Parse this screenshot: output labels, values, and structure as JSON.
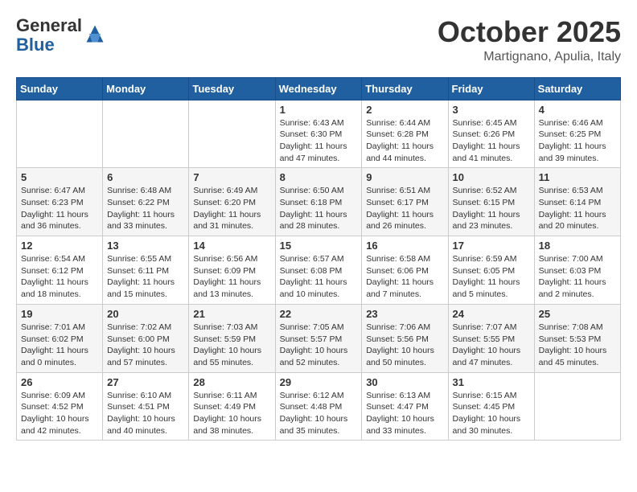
{
  "header": {
    "logo_general": "General",
    "logo_blue": "Blue",
    "month_title": "October 2025",
    "location": "Martignano, Apulia, Italy"
  },
  "weekdays": [
    "Sunday",
    "Monday",
    "Tuesday",
    "Wednesday",
    "Thursday",
    "Friday",
    "Saturday"
  ],
  "weeks": [
    [
      {
        "day": "",
        "info": ""
      },
      {
        "day": "",
        "info": ""
      },
      {
        "day": "",
        "info": ""
      },
      {
        "day": "1",
        "info": "Sunrise: 6:43 AM\nSunset: 6:30 PM\nDaylight: 11 hours\nand 47 minutes."
      },
      {
        "day": "2",
        "info": "Sunrise: 6:44 AM\nSunset: 6:28 PM\nDaylight: 11 hours\nand 44 minutes."
      },
      {
        "day": "3",
        "info": "Sunrise: 6:45 AM\nSunset: 6:26 PM\nDaylight: 11 hours\nand 41 minutes."
      },
      {
        "day": "4",
        "info": "Sunrise: 6:46 AM\nSunset: 6:25 PM\nDaylight: 11 hours\nand 39 minutes."
      }
    ],
    [
      {
        "day": "5",
        "info": "Sunrise: 6:47 AM\nSunset: 6:23 PM\nDaylight: 11 hours\nand 36 minutes."
      },
      {
        "day": "6",
        "info": "Sunrise: 6:48 AM\nSunset: 6:22 PM\nDaylight: 11 hours\nand 33 minutes."
      },
      {
        "day": "7",
        "info": "Sunrise: 6:49 AM\nSunset: 6:20 PM\nDaylight: 11 hours\nand 31 minutes."
      },
      {
        "day": "8",
        "info": "Sunrise: 6:50 AM\nSunset: 6:18 PM\nDaylight: 11 hours\nand 28 minutes."
      },
      {
        "day": "9",
        "info": "Sunrise: 6:51 AM\nSunset: 6:17 PM\nDaylight: 11 hours\nand 26 minutes."
      },
      {
        "day": "10",
        "info": "Sunrise: 6:52 AM\nSunset: 6:15 PM\nDaylight: 11 hours\nand 23 minutes."
      },
      {
        "day": "11",
        "info": "Sunrise: 6:53 AM\nSunset: 6:14 PM\nDaylight: 11 hours\nand 20 minutes."
      }
    ],
    [
      {
        "day": "12",
        "info": "Sunrise: 6:54 AM\nSunset: 6:12 PM\nDaylight: 11 hours\nand 18 minutes."
      },
      {
        "day": "13",
        "info": "Sunrise: 6:55 AM\nSunset: 6:11 PM\nDaylight: 11 hours\nand 15 minutes."
      },
      {
        "day": "14",
        "info": "Sunrise: 6:56 AM\nSunset: 6:09 PM\nDaylight: 11 hours\nand 13 minutes."
      },
      {
        "day": "15",
        "info": "Sunrise: 6:57 AM\nSunset: 6:08 PM\nDaylight: 11 hours\nand 10 minutes."
      },
      {
        "day": "16",
        "info": "Sunrise: 6:58 AM\nSunset: 6:06 PM\nDaylight: 11 hours\nand 7 minutes."
      },
      {
        "day": "17",
        "info": "Sunrise: 6:59 AM\nSunset: 6:05 PM\nDaylight: 11 hours\nand 5 minutes."
      },
      {
        "day": "18",
        "info": "Sunrise: 7:00 AM\nSunset: 6:03 PM\nDaylight: 11 hours\nand 2 minutes."
      }
    ],
    [
      {
        "day": "19",
        "info": "Sunrise: 7:01 AM\nSunset: 6:02 PM\nDaylight: 11 hours\nand 0 minutes."
      },
      {
        "day": "20",
        "info": "Sunrise: 7:02 AM\nSunset: 6:00 PM\nDaylight: 10 hours\nand 57 minutes."
      },
      {
        "day": "21",
        "info": "Sunrise: 7:03 AM\nSunset: 5:59 PM\nDaylight: 10 hours\nand 55 minutes."
      },
      {
        "day": "22",
        "info": "Sunrise: 7:05 AM\nSunset: 5:57 PM\nDaylight: 10 hours\nand 52 minutes."
      },
      {
        "day": "23",
        "info": "Sunrise: 7:06 AM\nSunset: 5:56 PM\nDaylight: 10 hours\nand 50 minutes."
      },
      {
        "day": "24",
        "info": "Sunrise: 7:07 AM\nSunset: 5:55 PM\nDaylight: 10 hours\nand 47 minutes."
      },
      {
        "day": "25",
        "info": "Sunrise: 7:08 AM\nSunset: 5:53 PM\nDaylight: 10 hours\nand 45 minutes."
      }
    ],
    [
      {
        "day": "26",
        "info": "Sunrise: 6:09 AM\nSunset: 4:52 PM\nDaylight: 10 hours\nand 42 minutes."
      },
      {
        "day": "27",
        "info": "Sunrise: 6:10 AM\nSunset: 4:51 PM\nDaylight: 10 hours\nand 40 minutes."
      },
      {
        "day": "28",
        "info": "Sunrise: 6:11 AM\nSunset: 4:49 PM\nDaylight: 10 hours\nand 38 minutes."
      },
      {
        "day": "29",
        "info": "Sunrise: 6:12 AM\nSunset: 4:48 PM\nDaylight: 10 hours\nand 35 minutes."
      },
      {
        "day": "30",
        "info": "Sunrise: 6:13 AM\nSunset: 4:47 PM\nDaylight: 10 hours\nand 33 minutes."
      },
      {
        "day": "31",
        "info": "Sunrise: 6:15 AM\nSunset: 4:45 PM\nDaylight: 10 hours\nand 30 minutes."
      },
      {
        "day": "",
        "info": ""
      }
    ]
  ]
}
